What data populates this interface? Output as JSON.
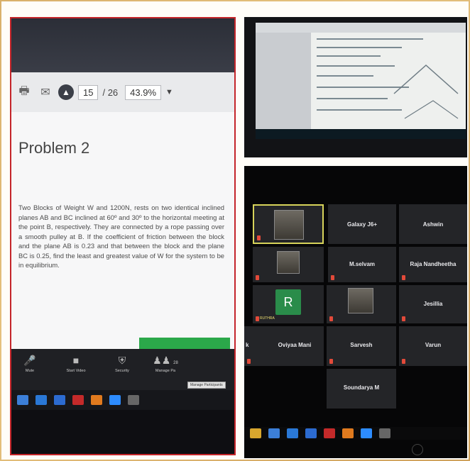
{
  "pdf_viewer": {
    "page_current": "15",
    "page_total": "/ 26",
    "zoom": "43.9%",
    "problem_title": "Problem 2",
    "problem_text": "Two Blocks of Weight W and 1200N, rests on two identical inclined planes AB and BC inclined at 60º and 30º to the horizontal meeting at the point B, respectively. They are connected by a rope passing over a smooth pulley at B. If the coefficient of friction between the block and the plane AB is 0.23 and that between the block and the plane BC is 0.25, find the least and greatest value of W for the system to be in equilibrium."
  },
  "meeting_controls": [
    {
      "name": "mute",
      "label": "Mute",
      "icon": "microphone-icon"
    },
    {
      "name": "start-video",
      "label": "Start Video",
      "icon": "video-icon"
    },
    {
      "name": "security",
      "label": "Security",
      "icon": "shield-icon"
    },
    {
      "name": "manage-participants",
      "label": "Manage Pa",
      "icon": "participants-icon"
    }
  ],
  "participants_count": "28",
  "gallery": {
    "tiles": [
      {
        "name": "Galaxy J6+"
      },
      {
        "name": "Ashwin"
      },
      {
        "name": "M.selvam"
      },
      {
        "name": "Raja Nandheetha"
      },
      {
        "name": "Jesillia"
      },
      {
        "name": "Oviyaa Mani"
      },
      {
        "name": "Sarvesh"
      },
      {
        "name": "Varun"
      },
      {
        "name": "Soundarya M"
      }
    ],
    "avatar_letter": "R",
    "avatar_label": "RUTHRA",
    "partial_name": "k"
  },
  "colors": {
    "frame_border": "#c4252a",
    "active_speaker": "#d7d35a",
    "avatar_green": "#2a8c4a",
    "muted_red": "#e24a3a"
  }
}
